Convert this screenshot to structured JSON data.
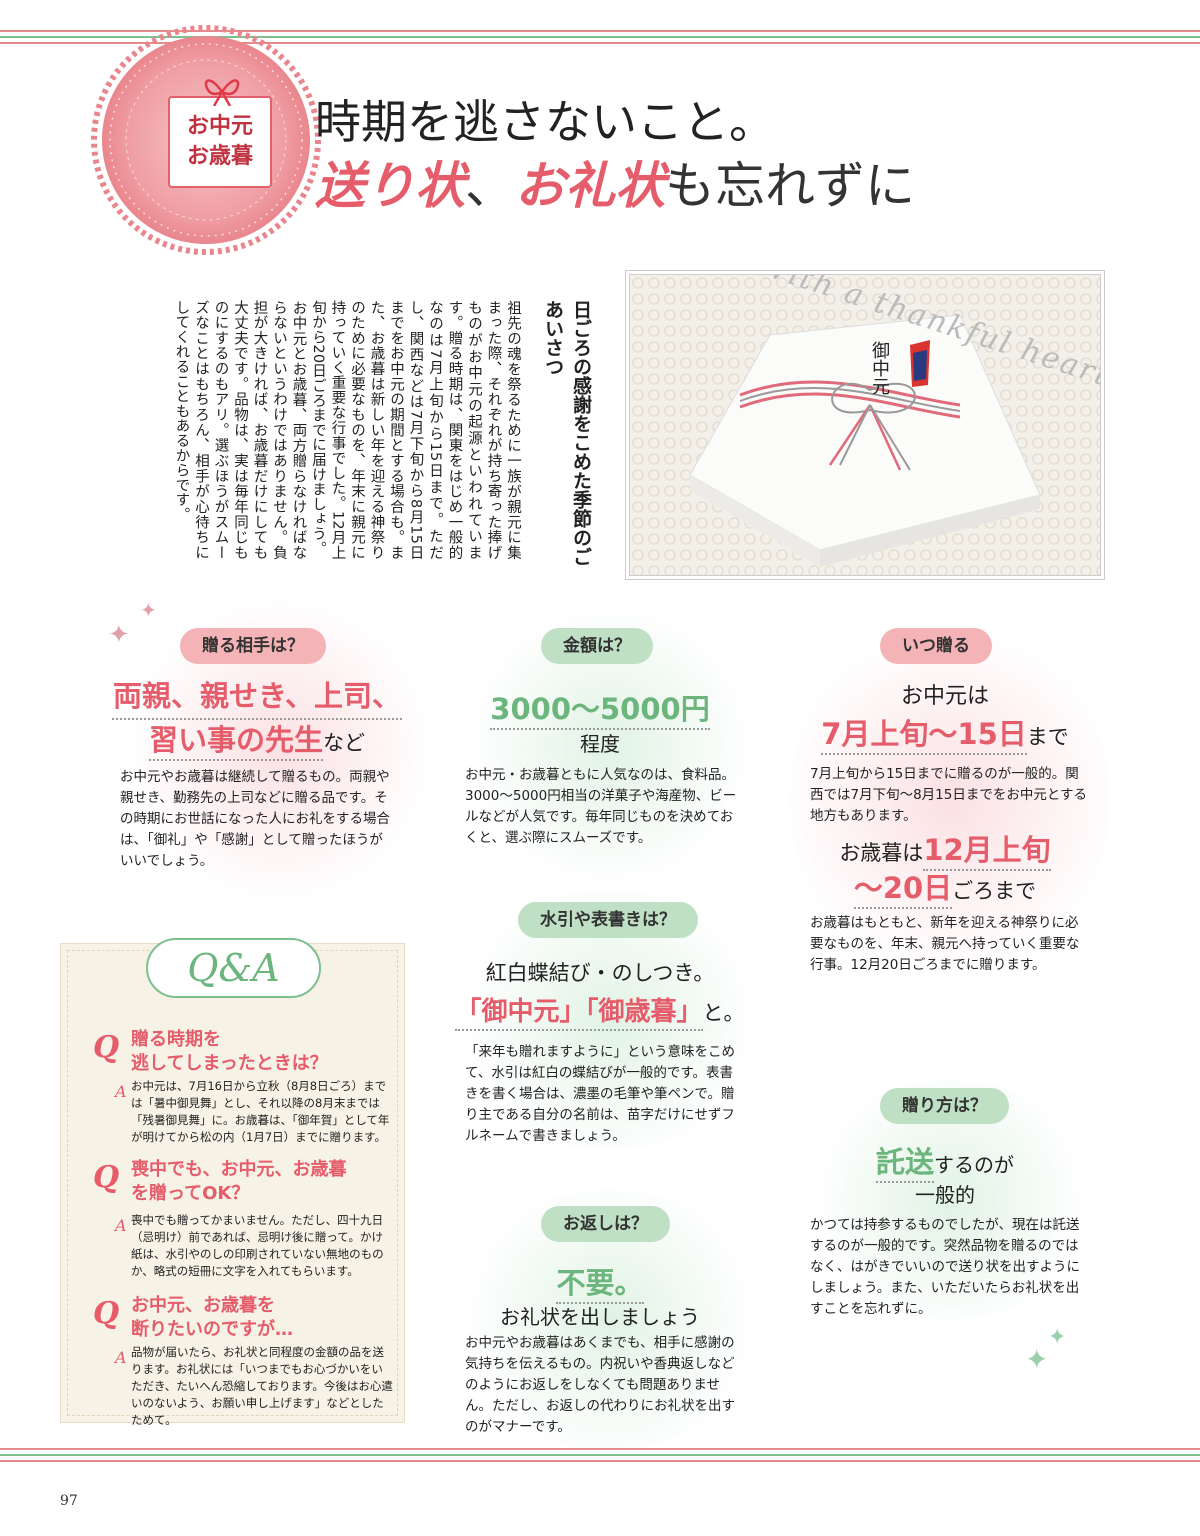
{
  "header": {
    "tag_line1": "お中元",
    "tag_line2": "お歳暮",
    "title_line1": "時期を逃さないこと。",
    "title_pink1": "送り状",
    "title_sep": "、",
    "title_pink2": "お礼状",
    "title_tail": "も忘れずに"
  },
  "intro": {
    "heading": "日ごろの感謝をこめた季節のごあいさつ",
    "body1": "祖先の魂を祭るために一族が親元に集まった際、それぞれが持ち寄った捧げものがお中元の起源といわれています。贈る時期は、関東をはじめ一般的なのは7月上旬から15日まで。ただし、関西などは7月下旬から8月15日までをお中元の期間とする場合も。また、お歳暮は新しい年を迎える神祭りのために必要なものを、年末に親元に持っていく重要な行事でした。12月上旬から20日ごろまでに届けましょう。",
    "body2": "お中元とお歳暮、両方贈らなければならないというわけではありません。負担が大きければ、お歳暮だけにしても大丈夫です。品物は、実は毎年同じものにするのもアリ。選ぶほうがスムーズなことはもちろん、相手が心待ちにしてくれることもあるからです。"
  },
  "photo": {
    "script": "With a thankful heart",
    "noshi_label": "御中元"
  },
  "sections": {
    "whom": {
      "pill": "贈る相手は？",
      "big_line1": "両親、親せき、上司、",
      "big_line2": "習い事の先生",
      "big_suffix": "など",
      "body": "お中元やお歳暮は継続して贈るもの。両親や親せき、勤務先の上司などに贈る品です。その時期にお世話になった人にお礼をする場合は、「御礼」や「感謝」として贈ったほうがいいでしょう。"
    },
    "amount": {
      "pill": "金額は？",
      "big": "3000～5000円",
      "sub": "程度",
      "body": "お中元・お歳暮ともに人気なのは、食料品。3000～5000円相当の洋菓子や海産物、ビールなどが人気です。毎年同じものを決めておくと、選ぶ際にスムーズです。"
    },
    "when": {
      "pill": "いつ贈る",
      "chugen_prefix": "お中元は",
      "chugen_big": "7月上旬～15日",
      "chugen_suffix": "まで",
      "chugen_body": "7月上旬から15日までに贈るのが一般的。関西では7月下旬～8月15日までをお中元とする地方もあります。",
      "seibo_prefix": "お歳暮は",
      "seibo_big1": "12月上旬",
      "seibo_big2": "～20日",
      "seibo_suffix": "ごろまで",
      "seibo_body": "お歳暮はもともと、新年を迎える神祭りに必要なものを、年末、親元へ持っていく重要な行事。12月20日ごろまでに贈ります。"
    },
    "mizuhiki": {
      "pill": "水引や表書きは？",
      "line1": "紅白蝶結び・のしつき。",
      "big": "「御中元」「御歳暮」",
      "suffix": "と。",
      "body": "「来年も贈れますように」という意味をこめて、水引は紅白の蝶結びが一般的です。表書きを書く場合は、濃墨の毛筆や筆ペンで。贈り主である自分の名前は、苗字だけにせずフルネームで書きましょう。"
    },
    "how": {
      "pill": "贈り方は？",
      "big": "託送",
      "suffix": "するのが",
      "line2": "一般的",
      "body": "かつては持参するものでしたが、現在は託送するのが一般的です。突然品物を贈るのではなく、はがきでいいので送り状を出すようにしましょう。また、いただいたらお礼状を出すことを忘れずに。"
    },
    "return": {
      "pill": "お返しは？",
      "big": "不要。",
      "line2": "お礼状を出しましょう",
      "body": "お中元やお歳暮はあくまでも、相手に感謝の気持ちを伝えるもの。内祝いや香典返しなどのようにお返しをしなくても問題ありません。ただし、お返しの代わりにお礼状を出すのがマナーです。"
    }
  },
  "qa": {
    "title": "Q&A",
    "q_mark": "Q",
    "a_mark": "A",
    "items": [
      {
        "q_line1": "贈る時期を",
        "q_line2": "逃してしまったときは？",
        "a": "お中元は、7月16日から立秋（8月8日ごろ）までは「暑中御見舞」とし、それ以降の8月末までは「残暑御見舞」に。お歳暮は、「御年賀」として年が明けてから松の内（1月7日）までに贈ります。"
      },
      {
        "q_line1": "喪中でも、お中元、お歳暮",
        "q_line2": "を贈ってOK？",
        "a": "喪中でも贈ってかまいません。ただし、四十九日（忌明け）前であれば、忌明け後に贈って。かけ紙は、水引やのしの印刷されていない無地のものか、略式の短冊に文字を入れてもらいます。"
      },
      {
        "q_line1": "お中元、お歳暮を",
        "q_line2": "断りたいのですが…",
        "a": "品物が届いたら、お礼状と同程度の金額の品を送ります。お礼状には「いつまでもお心づかいをいただき、たいへん恐縮しております。今後はお心遣いのないよう、お願い申し上げます」などとしたためて。"
      }
    ]
  },
  "footer": {
    "page_number": "97"
  },
  "colors": {
    "pink": "#e55c6b",
    "green": "#6cb57c",
    "pill_red": "#f4b3b6",
    "pill_green": "#bfe0c5"
  }
}
